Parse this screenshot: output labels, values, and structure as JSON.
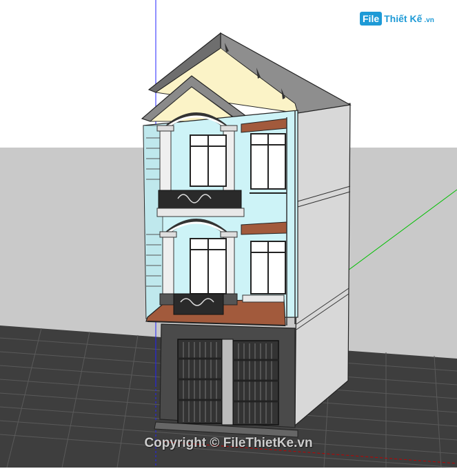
{
  "logo": {
    "box_text": "File",
    "brand_text": "Thiết Kế",
    "domain_text": ".vn"
  },
  "watermark": {
    "text": "Copyright © FileThietKe.vn"
  },
  "colors": {
    "sky": "#ffffff",
    "ground": "#c8c8c8",
    "road": "#3c3c3c",
    "wall_side": "#d9d9d9",
    "facade_light_blue": "#cdf3f7",
    "gable_cream": "#fbf3c7",
    "roof_gray": "#8d8d8d",
    "floor_tile": "#a25a3c",
    "ground_floor": "#4a4a4a",
    "axis_blue": "#0000ff",
    "axis_green": "#00c000",
    "axis_red": "#c00000",
    "brand": "#1e9ad6"
  }
}
